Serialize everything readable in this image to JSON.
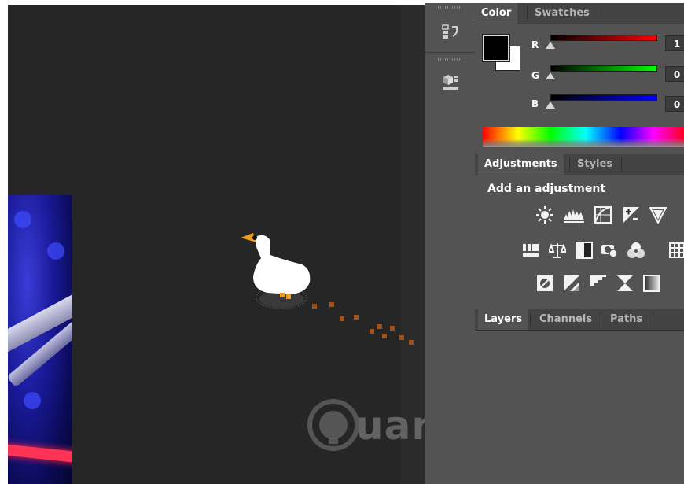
{
  "color_panel": {
    "tabs": [
      {
        "label": "Color",
        "active": true
      },
      {
        "label": "Swatches",
        "active": false
      }
    ],
    "foreground_color": "#000000",
    "background_color": "#ffffff",
    "sliders": [
      {
        "label": "R",
        "value": "1",
        "gradient": [
          "#000000",
          "#ff0000"
        ]
      },
      {
        "label": "G",
        "value": "0",
        "gradient": [
          "#000000",
          "#00ff00"
        ]
      },
      {
        "label": "B",
        "value": "0",
        "gradient": [
          "#000000",
          "#0000ff"
        ]
      }
    ]
  },
  "adjustments_panel": {
    "tabs": [
      {
        "label": "Adjustments",
        "active": true
      },
      {
        "label": "Styles",
        "active": false
      }
    ],
    "heading": "Add an adjustment",
    "icons": [
      [
        "brightness-icon",
        "levels-icon",
        "curves-icon",
        "exposure-icon",
        "vibrance-icon"
      ],
      [
        "hue-saturation-icon",
        "color-balance-icon",
        "black-white-icon",
        "photo-filter-icon",
        "channel-mixer-icon",
        "color-lookup-icon"
      ],
      [
        "invert-icon",
        "posterize-icon",
        "threshold-icon",
        "selective-color-icon",
        "gradient-map-icon"
      ]
    ]
  },
  "layers_panel": {
    "tabs": [
      {
        "label": "Layers",
        "active": true
      },
      {
        "label": "Channels",
        "active": false
      },
      {
        "label": "Paths",
        "active": false
      }
    ]
  },
  "tool_column": {
    "tools": [
      "history-icon",
      "3d-icon"
    ]
  },
  "canvas": {
    "background": "#262626",
    "sprite": "goose-icon",
    "watermark": "uantrimang"
  },
  "colors": {
    "panel_bg": "#535353",
    "tab_bg": "#434343",
    "footprints": "#a0521b"
  }
}
